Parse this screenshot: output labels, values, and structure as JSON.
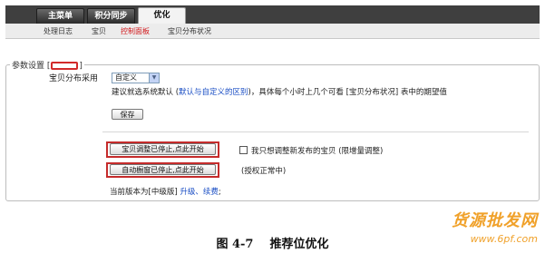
{
  "nav": {
    "tabs": [
      {
        "label": "主菜单"
      },
      {
        "label": "积分同步"
      },
      {
        "label": "优化"
      }
    ],
    "subnav": [
      "处理日志",
      "宝贝",
      "控制面板",
      "宝贝分布状况"
    ]
  },
  "params": {
    "legend_prefix": "参数设置 [",
    "legend_suffix": "]",
    "distribution_label": "宝贝分布采用",
    "distribution_select": "自定义",
    "hint_prefix": "建议就选系统默认 (",
    "hint_link": "默认与自定义的区别",
    "hint_suffix": ")，具体每个小时上几个可看 [宝贝分布状况] 表中的期望值",
    "save_button": "保存"
  },
  "actions": {
    "adjust_button": "宝贝调整已停止,点此开始",
    "checkbox_label": "我只想调整新发布的宝贝 (限增量调整)",
    "window_button": "自动橱窗已停止,点此开始",
    "auth_status": "(授权正常中)"
  },
  "footer": {
    "version_prefix": "当前版本为[中级版]",
    "upgrade_link": "升级、续费",
    "version_suffix": ";"
  },
  "caption": "图 4-7    推荐位优化",
  "watermark": {
    "line1": "货源批发网",
    "line2": "www.6pf.com"
  },
  "colors": {
    "highlight": "#c52b2b",
    "link": "#1a4ec4",
    "active_subnav": "#d2181b",
    "watermark": "#f0a12a"
  }
}
